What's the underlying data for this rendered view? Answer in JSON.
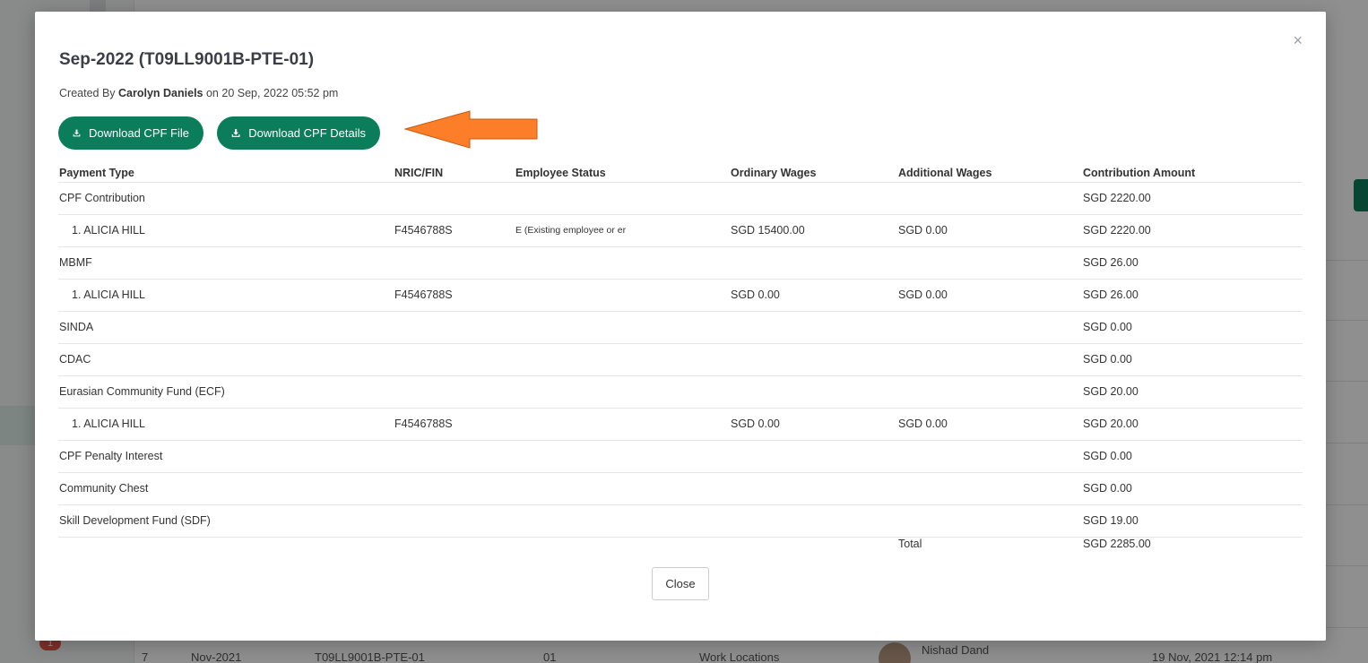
{
  "background": {
    "badge_count": "1",
    "row": {
      "index": "7",
      "month": "Nov-2021",
      "csn": "T09LL9001B-PTE-01",
      "code": "01",
      "location": "Work Locations",
      "user_name": "Nishad Dand",
      "timestamp": "19 Nov, 2021 12:14 pm"
    }
  },
  "modal": {
    "title": "Sep-2022 (T09LL9001B-PTE-01)",
    "created_prefix": "Created By",
    "created_by": "Carolyn Daniels",
    "created_on": "on 20 Sep, 2022 05:52 pm",
    "close_x": "×",
    "buttons": {
      "download_file": "Download CPF File",
      "download_details": "Download CPF Details",
      "close": "Close"
    },
    "table": {
      "headers": [
        "Payment Type",
        "NRIC/FIN",
        "Employee Status",
        "Ordinary Wages",
        "Additional Wages",
        "Contribution Amount"
      ],
      "rows": [
        {
          "type": "CPF Contribution",
          "nric": "",
          "status": "",
          "ow": "",
          "aw": "",
          "amount": "SGD 2220.00"
        },
        {
          "type": "1. ALICIA HILL",
          "nric": "F4546788S",
          "status": "E (Existing employee or er",
          "ow": "SGD 15400.00",
          "aw": "SGD 0.00",
          "amount": "SGD 2220.00"
        },
        {
          "type": "MBMF",
          "nric": "",
          "status": "",
          "ow": "",
          "aw": "",
          "amount": "SGD 26.00"
        },
        {
          "type": "1. ALICIA HILL",
          "nric": "F4546788S",
          "status": "",
          "ow": "SGD 0.00",
          "aw": "SGD 0.00",
          "amount": "SGD 26.00"
        },
        {
          "type": "SINDA",
          "nric": "",
          "status": "",
          "ow": "",
          "aw": "",
          "amount": "SGD 0.00"
        },
        {
          "type": "CDAC",
          "nric": "",
          "status": "",
          "ow": "",
          "aw": "",
          "amount": "SGD 0.00"
        },
        {
          "type": "Eurasian Community Fund (ECF)",
          "nric": "",
          "status": "",
          "ow": "",
          "aw": "",
          "amount": "SGD 20.00"
        },
        {
          "type": "1. ALICIA HILL",
          "nric": "F4546788S",
          "status": "",
          "ow": "SGD 0.00",
          "aw": "SGD 0.00",
          "amount": "SGD 20.00"
        },
        {
          "type": "CPF Penalty Interest",
          "nric": "",
          "status": "",
          "ow": "",
          "aw": "",
          "amount": "SGD 0.00"
        },
        {
          "type": "Community Chest",
          "nric": "",
          "status": "",
          "ow": "",
          "aw": "",
          "amount": "SGD 0.00"
        },
        {
          "type": "Skill Development Fund (SDF)",
          "nric": "",
          "status": "",
          "ow": "",
          "aw": "",
          "amount": "SGD 19.00"
        }
      ],
      "total_label": "Total",
      "total_amount": "SGD 2285.00"
    }
  },
  "colors": {
    "primary_green": "#0b7d5a",
    "arrow_orange": "#fd7e28"
  },
  "icons": [
    "download-icon",
    "close-icon",
    "arrow-annotation"
  ]
}
